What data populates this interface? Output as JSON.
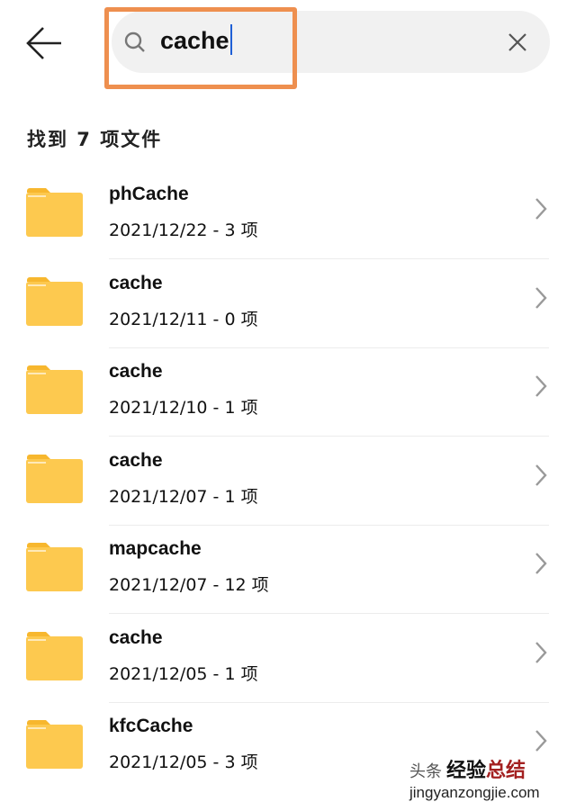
{
  "search": {
    "query": "cache",
    "back_icon": "arrow-left-icon",
    "search_icon": "search-icon",
    "clear_icon": "close-icon",
    "highlight_color": "#ee8f4f"
  },
  "results": {
    "count_label": "找到 7 项文件",
    "items": [
      {
        "name": "phCache",
        "meta": "2021/12/22 - 3 项"
      },
      {
        "name": "cache",
        "meta": "2021/12/11 - 0 项"
      },
      {
        "name": "cache",
        "meta": "2021/12/10 - 1 项"
      },
      {
        "name": "cache",
        "meta": "2021/12/07 - 1 项"
      },
      {
        "name": "mapcache",
        "meta": "2021/12/07 - 12 项"
      },
      {
        "name": "cache",
        "meta": "2021/12/05 - 1 项"
      },
      {
        "name": "kfcCache",
        "meta": "2021/12/05 - 3 项"
      }
    ]
  },
  "folder_color": "#fdc94f",
  "watermark": {
    "source": "头条",
    "title_a": "经验",
    "title_b": "总结",
    "url": "jingyanzongjie.com"
  }
}
